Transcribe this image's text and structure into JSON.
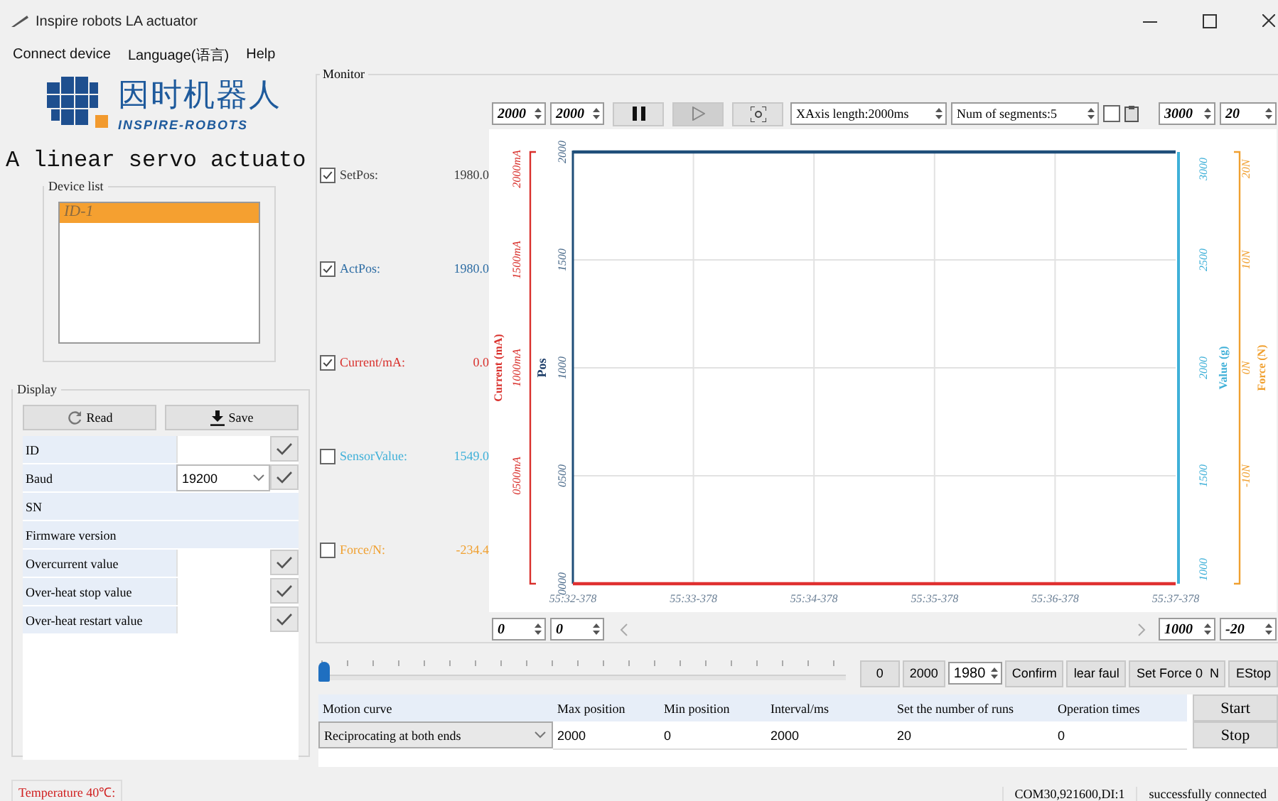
{
  "window": {
    "title": "Inspire robots LA actuator"
  },
  "menu": [
    {
      "label": "Connect device"
    },
    {
      "label": "Language(语言)"
    },
    {
      "label": "Help"
    }
  ],
  "logo": {
    "name": "因时机器人",
    "tagline": "INSPIRE-ROBOTS"
  },
  "heading": "A linear servo actuato",
  "device_list": {
    "title": "Device list",
    "items": [
      {
        "label": "ID-1",
        "selected": true
      }
    ]
  },
  "display": {
    "title": "Display",
    "buttons": [
      {
        "label": "Read",
        "kind": "read"
      },
      {
        "label": "Save",
        "kind": "save"
      }
    ],
    "rows": [
      {
        "label": "ID",
        "kind": "input"
      },
      {
        "label": "Baud",
        "kind": "select",
        "value": "19200"
      },
      {
        "label": "SN",
        "kind": "readonly"
      },
      {
        "label": "Firmware version",
        "kind": "readonly"
      },
      {
        "label": "Overcurrent value",
        "kind": "input"
      },
      {
        "label": "Over-heat stop value",
        "kind": "input"
      },
      {
        "label": "Over-heat restart value",
        "kind": "input"
      }
    ]
  },
  "monitor": {
    "title": "Monitor",
    "signals": [
      {
        "label": "SetPos:",
        "value": "1980.0",
        "checked": true,
        "color": "#3a3a3a"
      },
      {
        "label": "ActPos:",
        "value": "1980.0",
        "checked": true,
        "color": "#2e6da4"
      },
      {
        "label": "Current/mA:",
        "value": "0.0",
        "checked": true,
        "color": "#d9302c"
      },
      {
        "label": "SensorValue:",
        "value": "1549.0",
        "checked": false,
        "color": "#3fb0d8"
      },
      {
        "label": "Force/N:",
        "value": "-234.4",
        "checked": false,
        "color": "#f0a030"
      }
    ],
    "toolbar": {
      "left_spins": [
        "2000",
        "2000"
      ],
      "xaxis": "XAxis length:2000ms",
      "segments": "Num of segments:5",
      "checked": false,
      "right_spins": [
        "3000",
        "20"
      ]
    },
    "chart": {
      "chart_data": {
        "type": "line",
        "grid": true,
        "ylabel": "Pos",
        "x": [
          "55:32-378",
          "55:33-378",
          "55:34-378",
          "55:35-378",
          "55:36-378",
          "55:37-378"
        ],
        "ylim": [
          0,
          2000
        ],
        "yticks": [
          {
            "value": 0,
            "label": "0000"
          },
          {
            "value": 500,
            "label": "0500"
          },
          {
            "value": 1000,
            "label": "1000"
          },
          {
            "value": 1500,
            "label": "1500"
          },
          {
            "value": 2000,
            "label": "2000"
          }
        ],
        "series": [
          {
            "color": "#1f4e79",
            "values": [
              2000,
              2000,
              2000,
              2000,
              2000,
              2000
            ]
          },
          {
            "color": "#e03030",
            "values": [
              0,
              0,
              0,
              0,
              0,
              0
            ]
          }
        ]
      },
      "axes": [
        {
          "title": "Current (mA)",
          "kind": "left",
          "color": "#d9302c",
          "ticks": [
            "2000mA",
            "1500mA",
            "1000mA",
            "0500mA"
          ]
        },
        {
          "title": "Value (g)",
          "kind": "right",
          "color": "#3fb0d8",
          "ticks": [
            "3000",
            "2500",
            "2000",
            "1500",
            "1000"
          ]
        },
        {
          "title": "Force (N)",
          "kind": "outer",
          "color": "#f0a030",
          "ticks": [
            "20N",
            "10N",
            "0N",
            "-10N"
          ]
        }
      ]
    },
    "bottom_left_spins": [
      "0",
      "0"
    ],
    "bottom_right_spins": [
      "1000",
      "-20"
    ]
  },
  "control": {
    "slider": {
      "level": 0.0
    },
    "buttons": [
      {
        "label": "0",
        "kind": "button"
      },
      {
        "label": "2000",
        "kind": "button"
      },
      {
        "label": "1980",
        "kind": "spin"
      },
      {
        "label": "Confirm",
        "kind": "button"
      },
      {
        "label": "lear faul",
        "kind": "button"
      },
      {
        "label": "Set Force 0  N",
        "kind": "button"
      },
      {
        "label": "EStop",
        "kind": "button"
      }
    ],
    "table": {
      "columns": [
        "Motion curve",
        "Max position",
        "Min position",
        "Interval/ms",
        "Set the number of runs",
        "Operation times"
      ],
      "row": [
        "Reciprocating at both ends",
        "2000",
        "0",
        "2000",
        "20",
        "0"
      ]
    },
    "actions": [
      "Start",
      "Stop"
    ]
  },
  "status_bar": {
    "temperature": "Temperature 40℃:",
    "port": "COM30,921600,DI:1",
    "message": "successfully connected"
  }
}
